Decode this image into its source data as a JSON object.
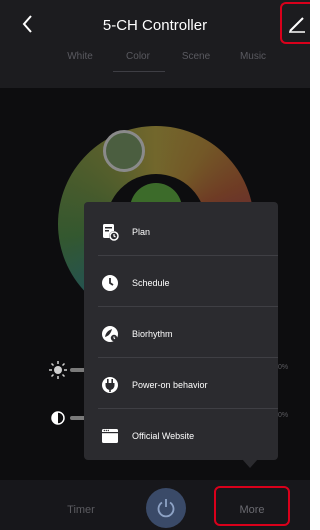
{
  "header": {
    "title": "5-CH Controller",
    "back_icon": "chevron-left-icon",
    "edit_icon": "pencil-icon"
  },
  "tabs": [
    {
      "label": "White",
      "active": false
    },
    {
      "label": "Color",
      "active": true
    },
    {
      "label": "Scene",
      "active": false
    },
    {
      "label": "Music",
      "active": false
    }
  ],
  "sliders": {
    "brightness": {
      "icon": "sun-icon",
      "value": "0%"
    },
    "contrast": {
      "icon": "contrast-icon",
      "value": "0%"
    }
  },
  "menu": {
    "items": [
      {
        "label": "Plan",
        "icon": "calendar-clock-icon"
      },
      {
        "label": "Schedule",
        "icon": "clock-icon"
      },
      {
        "label": "Biorhythm",
        "icon": "leaf-clock-icon"
      },
      {
        "label": "Power-on behavior",
        "icon": "plug-icon"
      },
      {
        "label": "Official Website",
        "icon": "browser-icon"
      }
    ]
  },
  "bottom_bar": {
    "timer_label": "Timer",
    "power_icon": "power-icon",
    "more_label": "More"
  },
  "colors": {
    "background": "#1c1c1f",
    "popup": "#2b2b2f",
    "highlight": "#d9001b",
    "power_button": "#3a4a68"
  }
}
